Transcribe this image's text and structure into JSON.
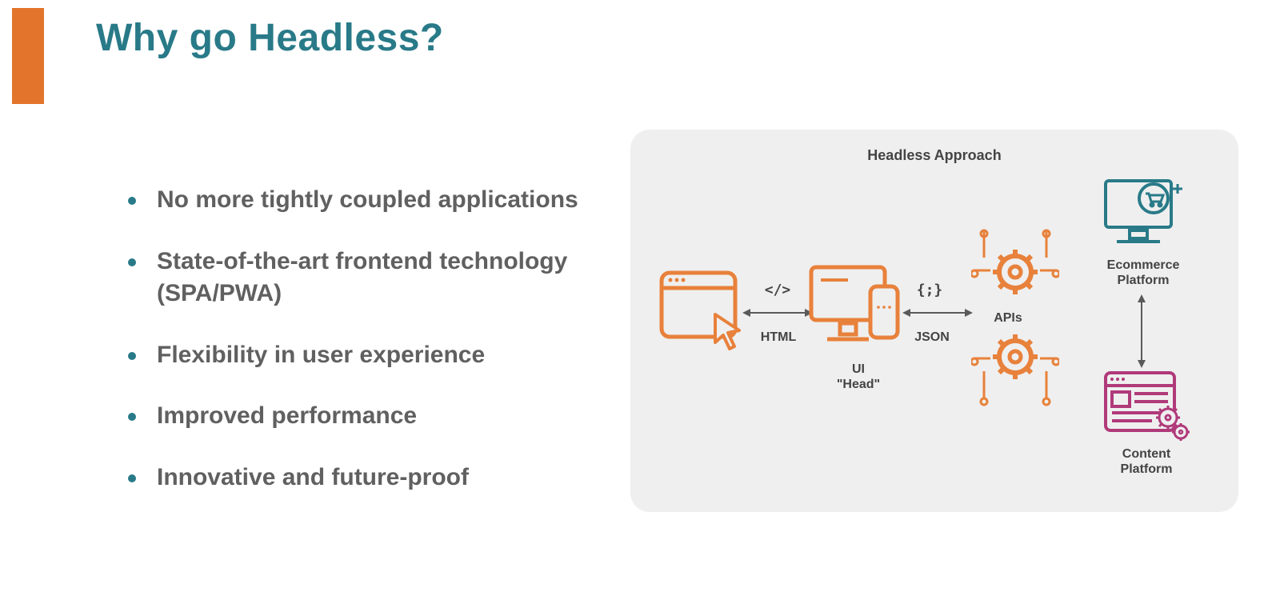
{
  "title": "Why go Headless?",
  "bullets": [
    "No more tightly coupled applications",
    "State-of-the-art frontend technology (SPA/PWA)",
    "Flexibility in user experience",
    "Improved performance",
    "Innovative and future-proof"
  ],
  "diagram": {
    "title": "Headless Approach",
    "html_glyph": "</>",
    "html_label": "HTML",
    "ui_head_label": "UI\n\"Head\"",
    "json_glyph": "{;}",
    "json_label": "JSON",
    "apis_label": "APIs",
    "ecommerce_label": "Ecommerce\nPlatform",
    "content_label": "Content\nPlatform"
  },
  "colors": {
    "teal": "#297A88",
    "orange": "#E8813B",
    "gray": "#6B6B6B",
    "magenta": "#B03A7A",
    "panel": "#EFEFEF"
  }
}
